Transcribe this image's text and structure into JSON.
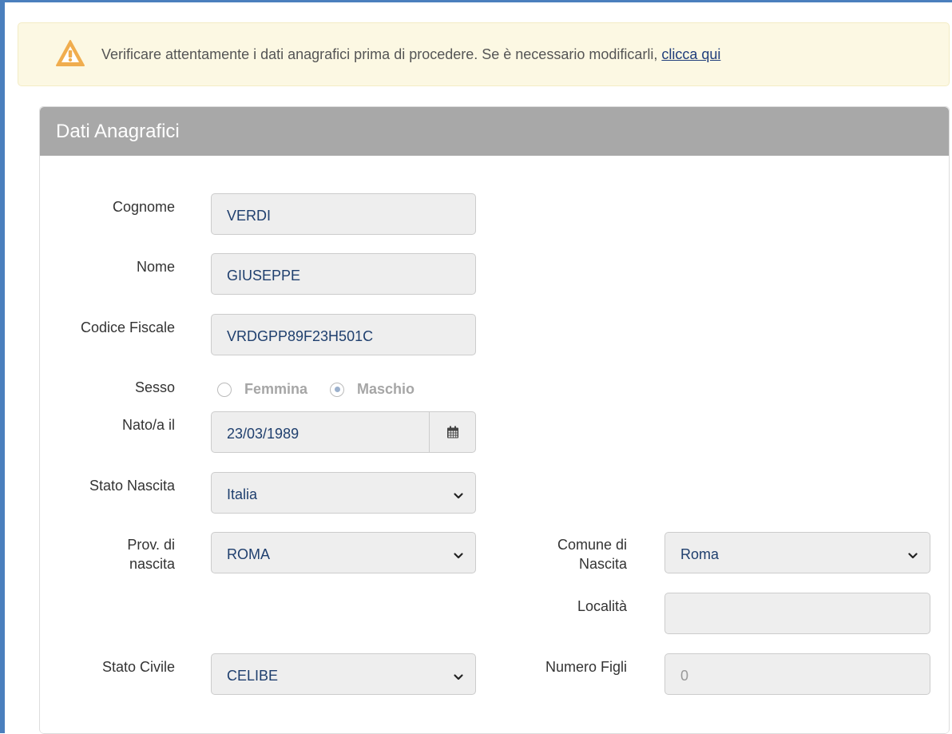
{
  "alert": {
    "text": "Verificare attentamente i dati anagrafici prima di procedere. Se è necessario modificarli,",
    "link": "clicca qui"
  },
  "panel": {
    "title": "Dati Anagrafici"
  },
  "form": {
    "cognome": {
      "label": "Cognome",
      "value": "VERDI"
    },
    "nome": {
      "label": "Nome",
      "value": "GIUSEPPE"
    },
    "codice_fiscale": {
      "label": "Codice Fiscale",
      "value": "VRDGPP89F23H501C"
    },
    "sesso": {
      "label": "Sesso",
      "options": [
        "Femmina",
        "Maschio"
      ],
      "selected": "Maschio"
    },
    "nato_il": {
      "label": "Nato/a il",
      "value": "23/03/1989"
    },
    "stato_nascita": {
      "label": "Stato Nascita",
      "value": "Italia"
    },
    "prov_nascita": {
      "label_line1": "Prov. di",
      "label_line2": "nascita",
      "value": "ROMA"
    },
    "comune_nascita": {
      "label_line1": "Comune di",
      "label_line2": "Nascita",
      "value": "Roma"
    },
    "localita": {
      "label": "Località",
      "value": ""
    },
    "stato_civile": {
      "label": "Stato Civile",
      "value": "CELIBE"
    },
    "numero_figli": {
      "label": "Numero Figli",
      "value": "0"
    }
  },
  "icons": {
    "alert": "warning-triangle-icon",
    "calendar": "calendar-icon",
    "select": "chevron-down-icon"
  },
  "colors": {
    "alert_bg": "#fcf8e3",
    "warning_orange": "#f0ad4e",
    "panel_heading": "#a8a8a8",
    "field_bg": "#eeeeee",
    "field_text": "#1f3f6e",
    "link": "#1e3c7a"
  }
}
